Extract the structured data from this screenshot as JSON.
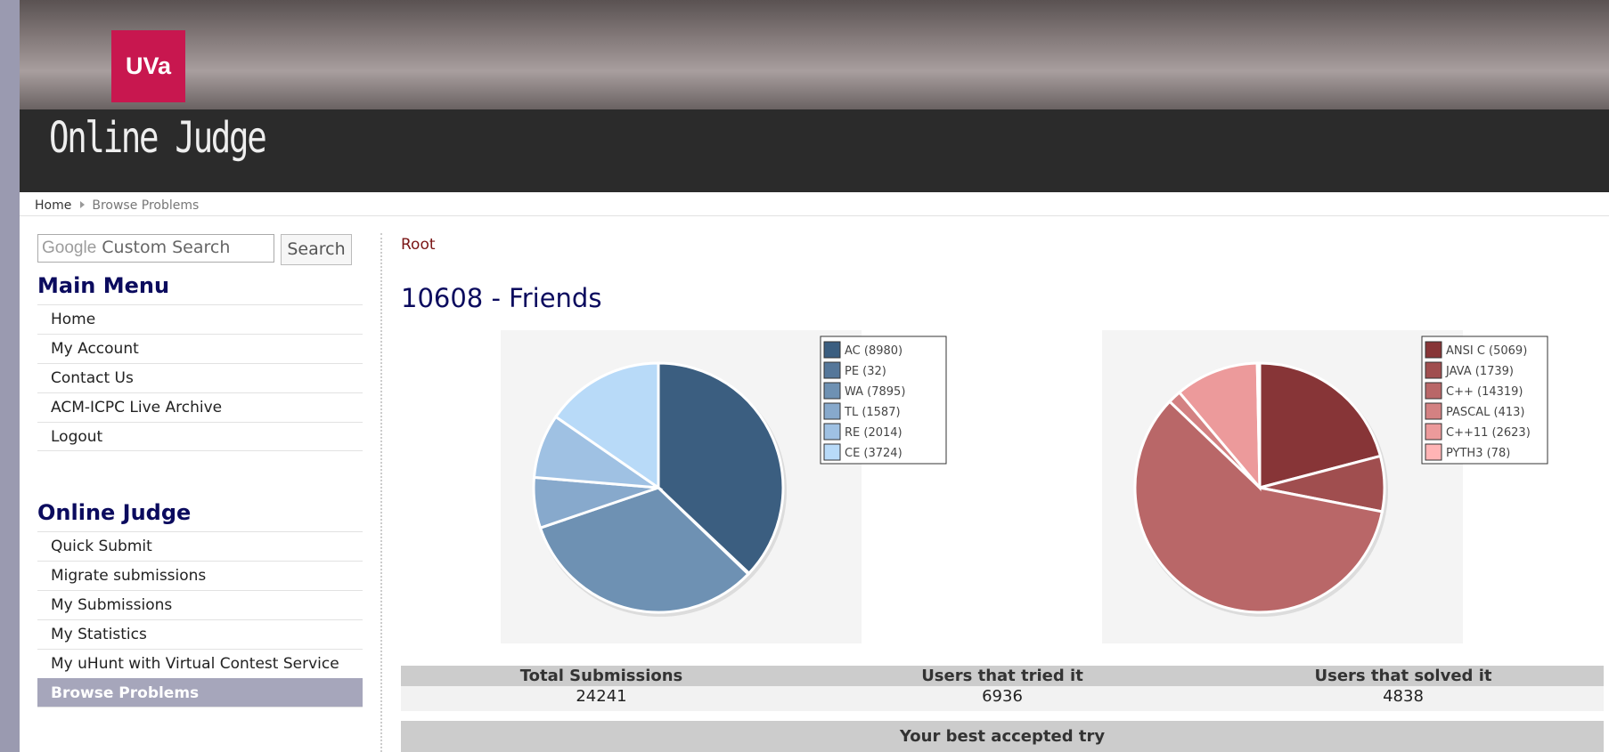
{
  "header": {
    "logo_text": "UVa",
    "site_title": "Online Judge"
  },
  "breadcrumb": {
    "home": "Home",
    "current": "Browse Problems"
  },
  "search": {
    "google_label": "Google",
    "placeholder": "Custom Search",
    "button_label": "Search"
  },
  "main_menu": {
    "title": "Main Menu",
    "items": [
      "Home",
      "My Account",
      "Contact Us",
      "ACM-ICPC Live Archive",
      "Logout"
    ]
  },
  "online_judge_menu": {
    "title": "Online Judge",
    "items": [
      "Quick Submit",
      "Migrate submissions",
      "My Submissions",
      "My Statistics",
      "My uHunt with Virtual Contest Service",
      "Browse Problems"
    ],
    "active": "Browse Problems"
  },
  "content": {
    "root_link": "Root",
    "problem_title": "10608 - Friends"
  },
  "chart_data": [
    {
      "type": "pie",
      "labels": [
        "AC (8980)",
        "PE (32)",
        "WA (7895)",
        "TL (1587)",
        "RE (2014)",
        "CE (3724)"
      ],
      "values": [
        8980,
        32,
        7895,
        1587,
        2014,
        3724
      ],
      "colors": [
        "#3b5e80",
        "#55779a",
        "#6e91b3",
        "#87a9cc",
        "#9fc1e3",
        "#b8daf8"
      ],
      "legend": "top-right"
    },
    {
      "type": "pie",
      "labels": [
        "ANSI C (5069)",
        "JAVA (1739)",
        "C++ (14319)",
        "PASCAL (413)",
        "C++11 (2623)",
        "PYTH3 (78)"
      ],
      "values": [
        5069,
        1739,
        14319,
        413,
        2623,
        78
      ],
      "colors": [
        "#873537",
        "#a04e4f",
        "#b96768",
        "#d38182",
        "#ec9a9b",
        "#ffb4b5"
      ],
      "legend": "top-right"
    }
  ],
  "stats": {
    "headers": [
      "Total Submissions",
      "Users that tried it",
      "Users that solved it"
    ],
    "values": [
      "24241",
      "6936",
      "4838"
    ]
  },
  "best_try": {
    "title": "Your best accepted try"
  }
}
